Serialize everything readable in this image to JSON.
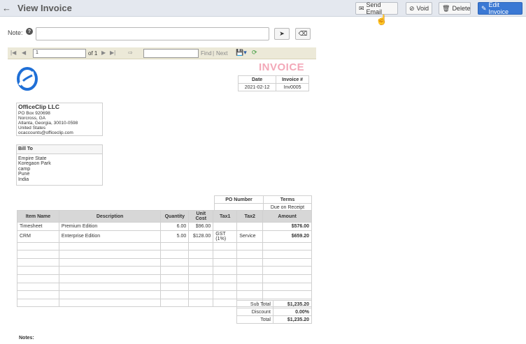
{
  "header": {
    "title": "View Invoice",
    "buttons": {
      "send_email": "Send Email",
      "void": "Void",
      "delete": "Delete",
      "edit_invoice": "Edit Invoice"
    }
  },
  "note": {
    "label": "Note:",
    "value": ""
  },
  "report_toolbar": {
    "page": "1",
    "of_label": "of 1",
    "find": "Find",
    "separator": "|",
    "next": "Next"
  },
  "invoice": {
    "heading": "INVOICE",
    "date_label": "Date",
    "number_label": "Invoice #",
    "date": "2021-02-12",
    "number": "Inv0005"
  },
  "company": {
    "name": "OfficeClip LLC",
    "lines": [
      "PO Box 920698",
      "Norcross, GA",
      "Atlanta, Georgia, 30010-0598",
      "United States",
      "ocaccounts@officeclip.com"
    ]
  },
  "bill_to": {
    "label": "Bill To",
    "lines": [
      "Empire State",
      "Koregaon Park",
      "camp",
      "Pune",
      "India"
    ]
  },
  "po": {
    "po_label": "PO Number",
    "terms_label": "Terms",
    "po_value": "",
    "terms_value": "Due on Receipt"
  },
  "items": {
    "columns": [
      "Item Name",
      "Description",
      "Quantity",
      "Unit Cost",
      "Tax1",
      "Tax2",
      "Amount"
    ],
    "rows": [
      [
        "Timesheet",
        "Premium Edition",
        "6.00",
        "$96.00",
        "",
        "",
        "$576.00"
      ],
      [
        "CRM",
        "Enterprise Edition",
        "5.00",
        "$128.00",
        "GST (1%)",
        "Service",
        "$659.20"
      ]
    ],
    "blank_rows": 8
  },
  "totals": [
    {
      "label": "Sub Total",
      "value": "$1,235.20"
    },
    {
      "label": "Discount",
      "value": "0.00%"
    },
    {
      "label": "Total",
      "value": "$1,235.20"
    }
  ],
  "notes_label": "Notes:"
}
